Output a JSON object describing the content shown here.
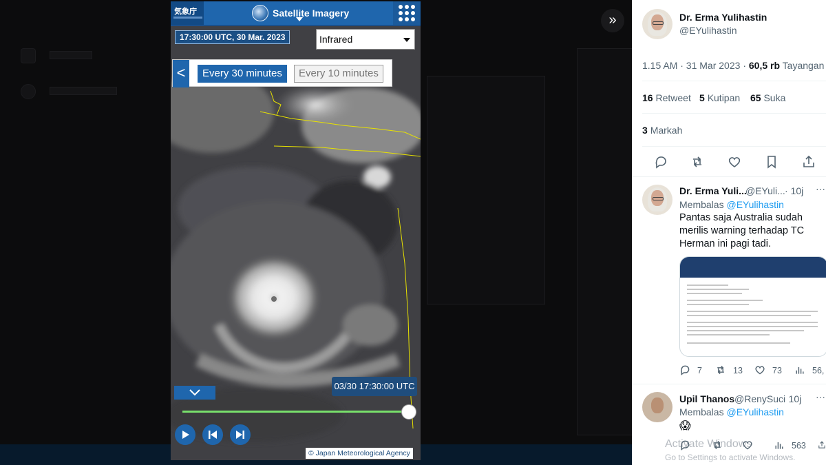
{
  "viewer": {
    "app": {
      "logo_text": "気象庁",
      "title": "Satellite Imagery",
      "timestamp": "17:30:00 UTC, 30 Mar. 2023",
      "band_select": "Infrared",
      "interval_back": "<",
      "interval_active": "Every 30 minutes",
      "interval_inactive": "Every 10 minutes",
      "frame_time": "03/30 17:30:00 UTC",
      "timeline_progress": 1.0,
      "credit": "© Japan Meteorological Agency"
    },
    "expand_icon": "»"
  },
  "tweet": {
    "author_name": "Dr. Erma Yulihastin",
    "author_handle": "@EYulihastin",
    "time": "1.15 AM · 31 Mar 2023",
    "views_count": "60,5 rb",
    "views_label": "Tayangan",
    "retweets_count": "16",
    "retweets_label": "Retweet",
    "quotes_count": "5",
    "quotes_label": "Kutipan",
    "likes_count": "65",
    "likes_label": "Suka",
    "bookmarks_count": "3",
    "bookmarks_label": "Markah"
  },
  "replies": [
    {
      "name": "Dr. Erma Yuli...",
      "handle": "@EYuli...",
      "age": "· 10j",
      "replying_label": "Membalas",
      "replying_to": "@EYulihastin",
      "text": "Pantas saja Australia sudah merilis warning terhadap TC Herman ini pagi tadi.",
      "stats": {
        "replies": "7",
        "retweets": "13",
        "likes": "73",
        "views": "56,"
      }
    },
    {
      "name": "Upil Thanos",
      "handle": "@RenySuci",
      "age": "· 10j",
      "replying_label": "Membalas",
      "replying_to": "@EYulihastin",
      "text": "😱",
      "stats": {
        "views": "563"
      }
    }
  ],
  "windows_watermark": {
    "title": "Activate Windows",
    "subtitle": "Go to Settings to activate Windows."
  },
  "colors": {
    "app_blue": "#1f66ad",
    "timeline_green": "#78e06b",
    "twitter_link": "#1d9bf0"
  }
}
